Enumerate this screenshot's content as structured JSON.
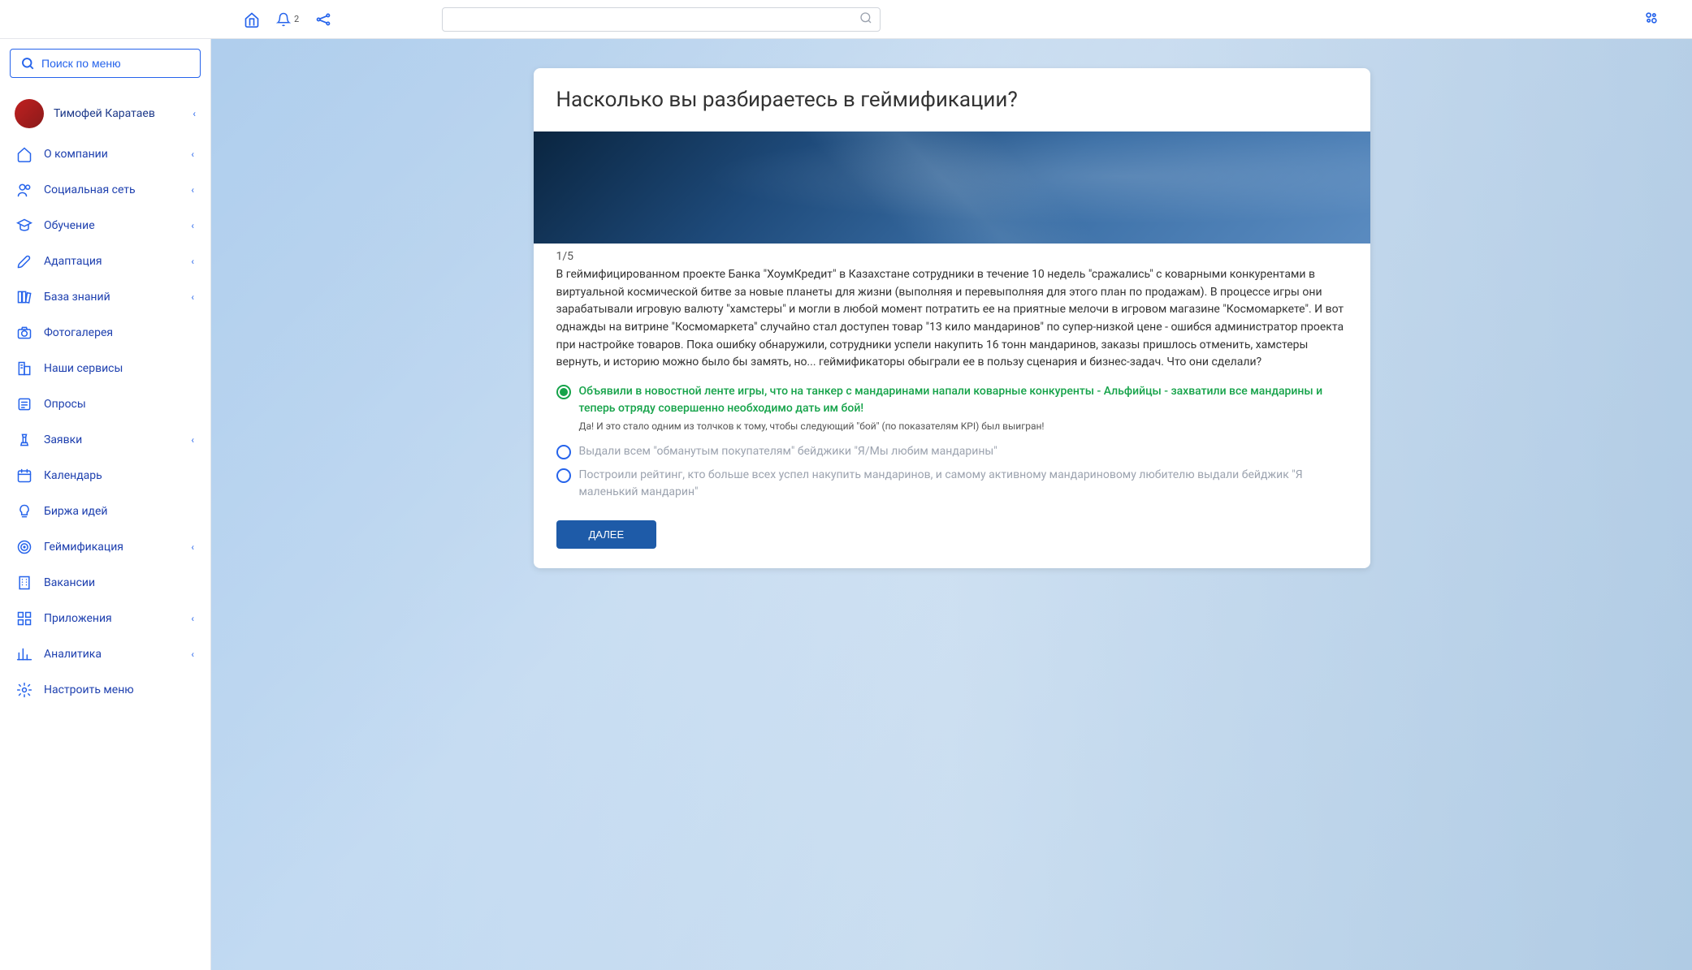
{
  "header": {
    "notif_count": "2",
    "search_placeholder": ""
  },
  "sidebar": {
    "menu_search_placeholder": "Поиск по меню",
    "user_name": "Тимофей Каратаев",
    "items": [
      {
        "label": "О компании",
        "icon": "home",
        "has_chevron": true
      },
      {
        "label": "Социальная сеть",
        "icon": "users",
        "has_chevron": true
      },
      {
        "label": "Обучение",
        "icon": "education",
        "has_chevron": true
      },
      {
        "label": "Адаптация",
        "icon": "rocket",
        "has_chevron": true
      },
      {
        "label": "База знаний",
        "icon": "books",
        "has_chevron": true
      },
      {
        "label": "Фотогалерея",
        "icon": "camera",
        "has_chevron": false
      },
      {
        "label": "Наши сервисы",
        "icon": "building",
        "has_chevron": false
      },
      {
        "label": "Опросы",
        "icon": "list",
        "has_chevron": false
      },
      {
        "label": "Заявки",
        "icon": "chess",
        "has_chevron": true
      },
      {
        "label": "Календарь",
        "icon": "calendar",
        "has_chevron": false
      },
      {
        "label": "Биржа идей",
        "icon": "bulb",
        "has_chevron": false
      },
      {
        "label": "Геймификация",
        "icon": "target",
        "has_chevron": true
      },
      {
        "label": "Вакансии",
        "icon": "office",
        "has_chevron": false
      },
      {
        "label": "Приложения",
        "icon": "apps",
        "has_chevron": true
      },
      {
        "label": "Аналитика",
        "icon": "chart",
        "has_chevron": true
      },
      {
        "label": "Настроить меню",
        "icon": "gear",
        "has_chevron": false
      }
    ]
  },
  "quiz": {
    "title": "Насколько вы разбираетесь в геймификации?",
    "counter": "1/5",
    "question": "В геймифицированном проекте Банка \"ХоумКредит\" в Казахстане сотрудники в течение 10 недель \"сражались\" с коварными конкурентами в виртуальной космической битве за новые планеты для жизни (выполняя и перевыполняя для этого план по продажам). В процессе игры они зарабатывали игровую валюту \"хамстеры\" и могли в любой момент потратить ее на приятные мелочи в игровом магазине \"Космомаркете\". И вот однажды на витрине \"Космомаркета\" случайно стал доступен товар \"13 кило мандаринов\" по супер-низкой цене - ошибся администратор проекта при настройке товаров. Пока ошибку обнаружили, сотрудники успели накупить 16 тонн мандаринов, заказы пришлось отменить, хамстеры вернуть, и историю можно было бы замять, но... геймификаторы обыграли ее в пользу сценария и бизнес-задач. Что они сделали?",
    "options": [
      {
        "text": "Объявили в новостной ленте игры, что на танкер с мандаринами напали коварные конкуренты - Альфийцы - захватили все мандарины и теперь отряду совершенно необходимо дать им бой!",
        "correct": true
      },
      {
        "text": "Выдали всем \"обманутым покупателям\" бейджики \"Я/Мы любим мандарины\"",
        "correct": false
      },
      {
        "text": "Построили рейтинг, кто больше всех успел накупить мандаринов, и самому активному мандариновому любителю выдали бейджик \"Я маленький мандарин\"",
        "correct": false
      }
    ],
    "feedback": "Да! И это стало одним из толчков к тому, чтобы следующий \"бой\" (по показателям KPI) был выигран!",
    "next_button": "ДАЛЕЕ"
  }
}
